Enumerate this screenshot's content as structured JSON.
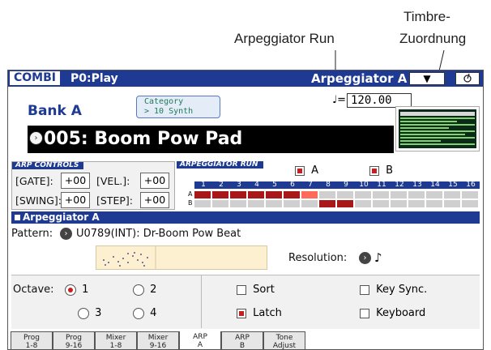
{
  "callouts": {
    "arp_run": "Arpeggiator Run",
    "timbre": [
      "Timbre-",
      "Zuordnung"
    ]
  },
  "titlebar": {
    "mode": "COMBI",
    "page": "P0:Play",
    "title": "Arpeggiator A",
    "menu_button": "▼"
  },
  "header": {
    "bank": "Bank A",
    "category_label": "Category",
    "category_value": "> 10 Synth",
    "tempo_prefix": "♩=",
    "tempo": "120.00",
    "program": "005: Boom Pow Pad"
  },
  "arp_controls": {
    "title": "ARP CONTROLS",
    "gate_label": "[GATE]:",
    "gate": "+00",
    "vel_label": "[VEL.]:",
    "vel": "+00",
    "swing_label": "[SWING]:",
    "swing": "+00",
    "step_label": "[STEP]:",
    "step": "+00"
  },
  "arp_run": {
    "title": "ARPEGGIATOR RUN",
    "a_label": "A",
    "b_label": "B",
    "a_checked": true,
    "b_checked": true,
    "steps": [
      "1",
      "2",
      "3",
      "4",
      "5",
      "6",
      "7",
      "8",
      "9",
      "10",
      "11",
      "12",
      "13",
      "14",
      "15",
      "16"
    ],
    "row_a_label": "A",
    "row_b_label": "B",
    "row_a": [
      "on",
      "on",
      "on",
      "on",
      "on",
      "on",
      "hi",
      "off",
      "off",
      "off",
      "off",
      "off",
      "off",
      "off",
      "off",
      "off"
    ],
    "row_b": [
      "off",
      "off",
      "off",
      "off",
      "off",
      "off",
      "off",
      "on",
      "on",
      "off",
      "off",
      "off",
      "off",
      "off",
      "off",
      "off"
    ]
  },
  "arpeggiator_a": {
    "title": "Arpeggiator A",
    "pattern_label": "Pattern:",
    "pattern": "U0789(INT): Dr-Boom Pow Beat",
    "resolution_label": "Resolution:",
    "resolution": "♪",
    "octave_label": "Octave:",
    "octave_options": [
      "1",
      "2",
      "3",
      "4"
    ],
    "octave_selected": "1",
    "sort": "Sort",
    "latch": "Latch",
    "key_sync": "Key Sync.",
    "keyboard": "Keyboard"
  },
  "tabs": [
    {
      "line1": "Prog",
      "line2": "1-8"
    },
    {
      "line1": "Prog",
      "line2": "9-16"
    },
    {
      "line1": "Mixer",
      "line2": "1-8"
    },
    {
      "line1": "Mixer",
      "line2": "9-16"
    },
    {
      "line1": "ARP",
      "line2": "A"
    },
    {
      "line1": "ARP",
      "line2": "B"
    },
    {
      "line1": "Tone",
      "line2": "Adjust"
    }
  ],
  "colors": {
    "accent": "#1f3a92",
    "step_on": "#a81818",
    "step_hi": "#ff6a5a",
    "step_off": "#cfcfcf"
  }
}
